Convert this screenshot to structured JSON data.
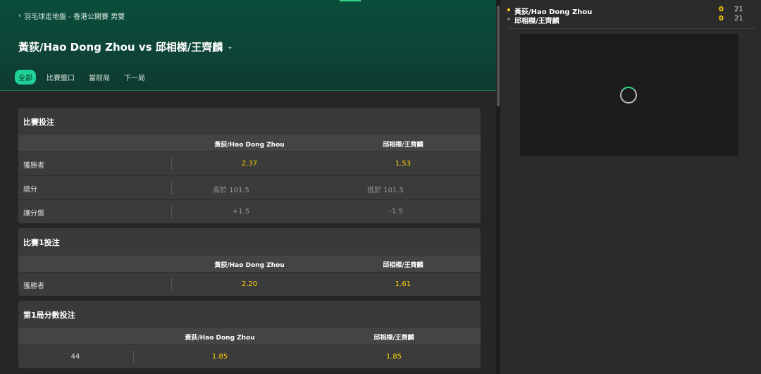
{
  "header": {
    "breadcrumb": "羽毛球走地盤 - 香港公開賽 男雙",
    "title": "黃荻/Hao Dong Zhou vs 邱相榤/王齊麟",
    "tabs": [
      "全部",
      "比賽盤口",
      "當前局",
      "下一局"
    ],
    "active_tab": "全部"
  },
  "cards": [
    {
      "title": "比賽投注",
      "columns": [
        "黃荻/Hao Dong Zhou",
        "邱相榤/王齊麟"
      ],
      "rows": [
        {
          "label": "獲勝者",
          "home": "2.37",
          "away": "1.53"
        },
        {
          "label": "總分",
          "home": "高於 101.5",
          "away": "低於 101.5"
        },
        {
          "label": "讓分盤",
          "home": "+1.5",
          "away": "-1.5"
        }
      ]
    },
    {
      "title": "比賽1投注",
      "columns": [
        "黃荻/Hao Dong Zhou",
        "邱相榤/王齊麟"
      ],
      "rows": [
        {
          "label": "獲勝者",
          "home": "2.20",
          "away": "1.61"
        }
      ]
    },
    {
      "title": "第1局分數投注",
      "columns": [
        "黃荻/Hao Dong Zhou",
        "邱相榤/王齊麟"
      ],
      "rows": [
        {
          "label": "44",
          "home": "1.85",
          "away": "1.85"
        }
      ]
    }
  ],
  "scoreboard": {
    "players": [
      {
        "name": "黃荻/Hao Dong Zhou",
        "current": "0",
        "total": "21",
        "serving": true
      },
      {
        "name": "邱相榤/王齊麟",
        "current": "0",
        "total": "21",
        "serving": false
      }
    ]
  },
  "colors": {
    "accent": "#1fd197",
    "odds": "#ffd200",
    "serve_dot": "#ffd200",
    "idle_dot": "#777777"
  },
  "icons": {
    "breadcrumb_back": "chevron-left-icon",
    "title_dropdown": "chevron-down-icon",
    "video_loading": "loading-spinner-icon"
  }
}
